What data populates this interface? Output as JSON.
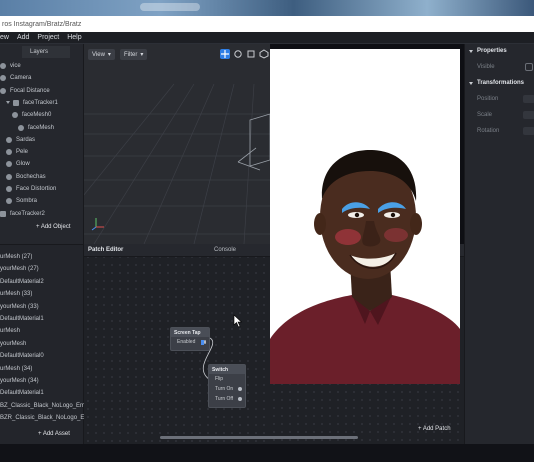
{
  "window": {
    "title": "ros Instagram/Bratz/Bratz"
  },
  "menu": [
    "ew",
    "Add",
    "Project",
    "Help"
  ],
  "scene": {
    "tab_label": "Layers",
    "items": [
      {
        "label": "vice",
        "indent": 0,
        "icon": "device-icon"
      },
      {
        "label": "Camera",
        "indent": 0,
        "icon": "camera-icon"
      },
      {
        "label": "Focal Distance",
        "indent": 0,
        "icon": "focal-distance-icon"
      },
      {
        "label": "faceTracker1",
        "indent": 1,
        "icon": "face-tracker-icon"
      },
      {
        "label": "faceMesh0",
        "indent": 2,
        "icon": "face-mesh-icon"
      },
      {
        "label": "faceMesh",
        "indent": 3,
        "icon": "face-mesh-icon"
      },
      {
        "label": "Sardas",
        "indent": 1,
        "icon": "mesh-icon"
      },
      {
        "label": "Pele",
        "indent": 1,
        "icon": "mesh-icon"
      },
      {
        "label": "Glow",
        "indent": 1,
        "icon": "mesh-icon"
      },
      {
        "label": "Bochechas",
        "indent": 1,
        "icon": "mesh-icon"
      },
      {
        "label": "Face Distortion",
        "indent": 1,
        "icon": "mesh-icon"
      },
      {
        "label": "Sombra",
        "indent": 1,
        "icon": "mesh-icon"
      },
      {
        "label": "faceTracker2",
        "indent": 0,
        "icon": "face-tracker-icon"
      }
    ],
    "add_object_label": "+ Add Object"
  },
  "assets": {
    "items": [
      "urMesh (27)",
      "yourMesh (27)",
      "DefaultMaterial2",
      "urMesh (33)",
      "yourMesh (33)",
      "DefaultMaterial1",
      "urMesh",
      "yourMesh",
      "DefaultMaterial0",
      "urMesh (34)",
      "yourMesh (34)",
      "DefaultMaterial1",
      "BZ_Classic_Black_NoLogo_Em...",
      "BZR_Classic_Black_NoLogo_E..."
    ],
    "add_asset_label": "+ Add Asset"
  },
  "viewport": {
    "view_label": "View",
    "filter_label": "Filter"
  },
  "patch_editor": {
    "title": "Patch Editor",
    "console_title": "Console",
    "add_patch_label": "+ Add Patch",
    "nodes": {
      "screen_tap": {
        "title": "Screen Tap",
        "enabled_label": "Enabled"
      },
      "switch": {
        "title": "Switch",
        "rows": [
          "Flip",
          "Turn On",
          "Turn Off"
        ]
      }
    }
  },
  "properties": {
    "title": "Properties",
    "visible_label": "Visible",
    "transformations_title": "Transformations",
    "position_label": "Position",
    "scale_label": "Scale",
    "rotation_label": "Rotation"
  },
  "colors": {
    "accent_blue": "#4a8ef0",
    "panel_bg": "#25272d",
    "patch_bg": "#1f2126"
  }
}
